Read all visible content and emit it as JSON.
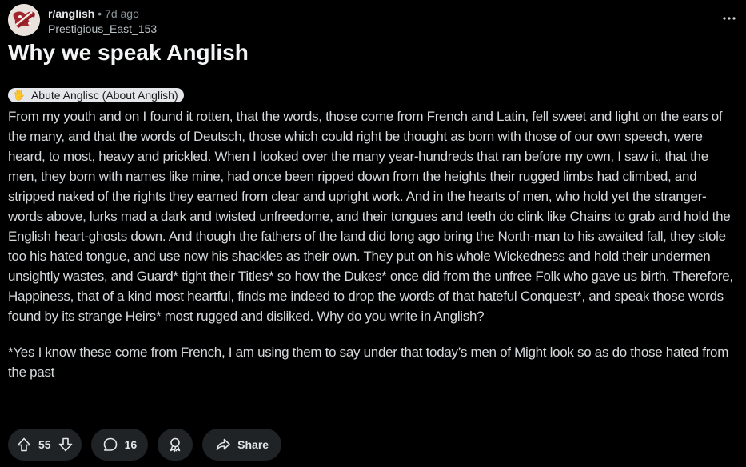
{
  "post": {
    "subreddit": "r/anglish",
    "separator": "•",
    "age": "7d ago",
    "author": "Prestigious_East_153",
    "title": "Why we speak Anglish",
    "flair": {
      "icon": "🖐",
      "label": "Abute Anglisc (About Anglish)"
    },
    "paragraphs": [
      "From my youth and on I found it rotten, that the words, those come from French and Latin, fell sweet and light on the ears of the many, and that the words of Deutsch, those which could right be thought as born with those of our own speech, were heard, to most, heavy and prickled. When I looked over the many year-hundreds that ran before my own, I saw it, that the men, they born with names like mine, had once been ripped down from the heights their rugged limbs had climbed, and stripped naked of the rights they earned from clear and upright work. And in the hearts of men, who hold yet the stranger-words above, lurks mad a dark and twisted unfreedome, and their tongues and teeth do clink like Chains to grab and hold the English heart-ghosts down. And though the fathers of the land did long ago bring the North-man to his awaited fall, they stole too his hated tongue, and use now his shackles as their own. They put on his whole Wickedness and hold their undermen unsightly wastes, and Guard* tight their Titles* so how the Dukes* once did from the unfree Folk who gave us birth. Therefore, Happiness, that of a kind most heartful, finds me indeed to drop the words of that hateful Conquest*, and speak those words found by its strange Heirs* most rugged and disliked. Why do you write in Anglish?",
      "*Yes I know these come from French, I am using them to say under that today’s men of Might look so as do those hated from the past"
    ]
  },
  "actions": {
    "votes": "55",
    "comments": "16",
    "share_label": "Share"
  },
  "colors": {
    "background": "#000000",
    "pill": "#1f2326",
    "flair_bg": "#e4e6ea",
    "text": "#d7dadc",
    "muted": "#8b9599"
  },
  "icons": {
    "overflow": "more-horizontal-icon",
    "upvote": "arrow-up-icon",
    "downvote": "arrow-down-icon",
    "comment": "speech-bubble-icon",
    "award": "award-ribbon-icon",
    "share": "share-arrow-icon"
  }
}
